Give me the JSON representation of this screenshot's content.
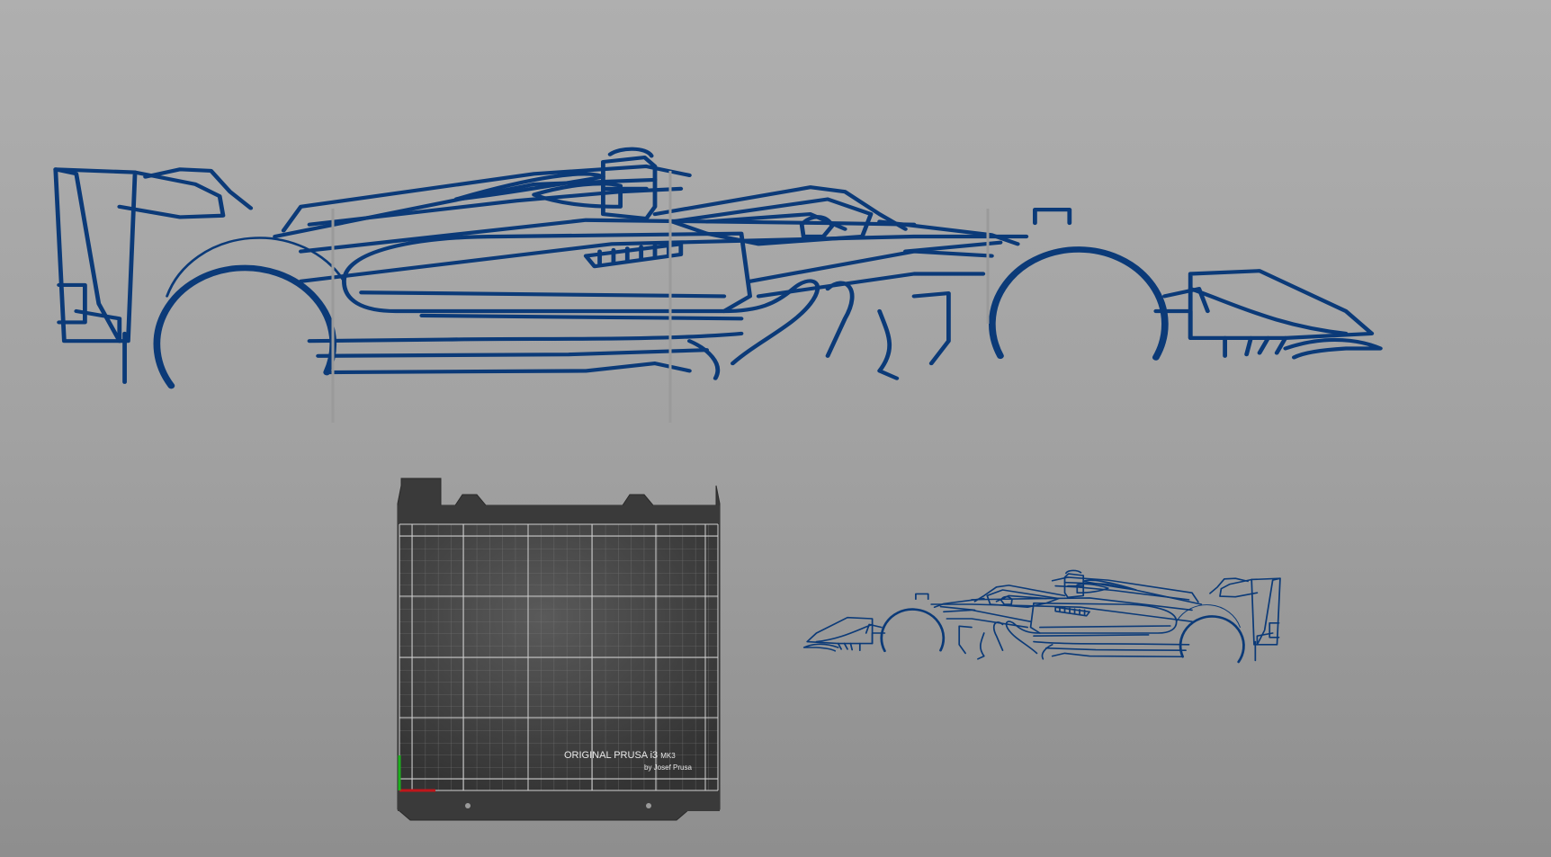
{
  "viewport": {
    "background_top": "#afafaf",
    "background_bottom": "#8e8e8e"
  },
  "model": {
    "outline_color": "#0b3a78"
  },
  "bed": {
    "brand_line1": "ORIGINAL PRUSA i3",
    "brand_model": "MK3",
    "brand_line2": "by Josef Prusa",
    "bed_color": "#3a3a3a",
    "grid_color": "#cfcfcf",
    "axis_x_color": "#c0161b",
    "axis_y_color": "#1db01d"
  }
}
